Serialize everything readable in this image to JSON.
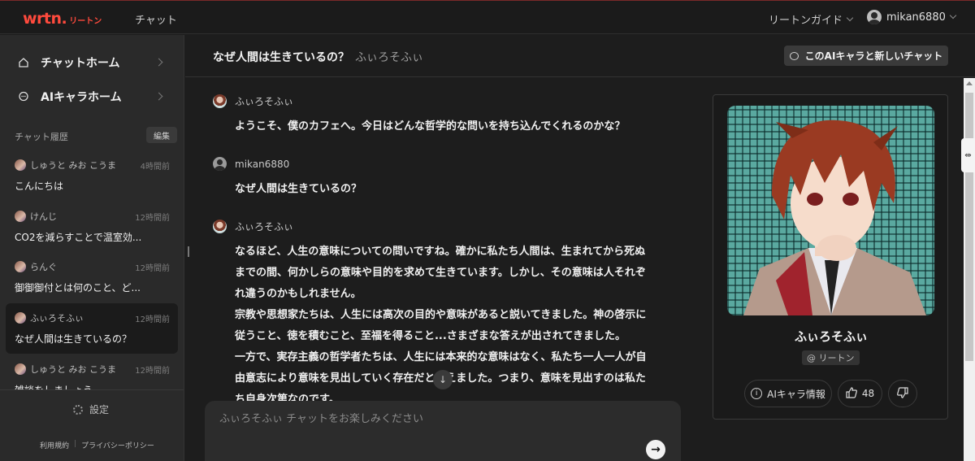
{
  "app": {
    "logo": "wrtn.",
    "logo_sub": "リートン",
    "nav_chat": "チャット"
  },
  "header_right": {
    "guide": "リートンガイド",
    "username": "mikan6880"
  },
  "sidebar": {
    "nav": [
      {
        "label": "チャットホーム",
        "icon": "home-icon"
      },
      {
        "label": "AIキャラホーム",
        "icon": "chat-bubble-icon"
      }
    ],
    "history_label": "チャット履歴",
    "edit_label": "編集",
    "history": [
      {
        "name": "しゅうと みお こうま",
        "time": "4時間前",
        "message": "こんにちは"
      },
      {
        "name": "けんじ",
        "time": "12時間前",
        "message": "CO2を減らすことで温室効..."
      },
      {
        "name": "らんぐ",
        "time": "12時間前",
        "message": "御御御付とは何のこと、ど..."
      },
      {
        "name": "ふぃろそふぃ",
        "time": "12時間前",
        "message": "なぜ人間は生きているの？",
        "active": true
      },
      {
        "name": "しゅうと みお こうま",
        "time": "12時間前",
        "message": "雑談をしましょう"
      }
    ],
    "settings_label": "設定",
    "footer_links": [
      "利用規約",
      "プライバシーポリシー"
    ]
  },
  "chat_header": {
    "title": "なぜ人間は生きているの？",
    "character": "ふぃろそふぃ",
    "new_chat_label": "このAIキャラと新しいチャット"
  },
  "messages": [
    {
      "sender": "ふぃろそふぃ",
      "role": "ai",
      "text": "ようこそ、僕のカフェへ。今日はどんな哲学的な問いを持ち込んでくれるのかな？"
    },
    {
      "sender": "mikan6880",
      "role": "user",
      "text": "なぜ人間は生きているの？"
    },
    {
      "sender": "ふぃろそふぃ",
      "role": "ai",
      "lines": [
        "なるほど、人生の意味についての問いですね。確かに私たち人間は、生まれてから死ぬ",
        "までの間、何かしらの意味や目的を求めて生きています。しかし、その意味は人それぞ",
        "れ違うのかもしれません。",
        "宗教や思想家たちは、人生には高次の目的や意味があると説いてきました。神の啓示に",
        "従うこと、徳を積むこと、至福を得ること...さまざまな答えが出されてきました。",
        "一方で、実存主義の哲学者たちは、人生には本来的な意味はなく、私たち一人一人が自",
        "由意志により意味を見出していく存在だと考えました。つまり、意味を見出すのは私た",
        "ち自身次第なのです。"
      ]
    }
  ],
  "input": {
    "placeholder": "ふぃろそふぃ チャットをお楽しみください"
  },
  "character_card": {
    "name": "ふぃろそふぃ",
    "tag": "@ リートン",
    "info_label": "AIキャラ情報",
    "likes": "48"
  }
}
